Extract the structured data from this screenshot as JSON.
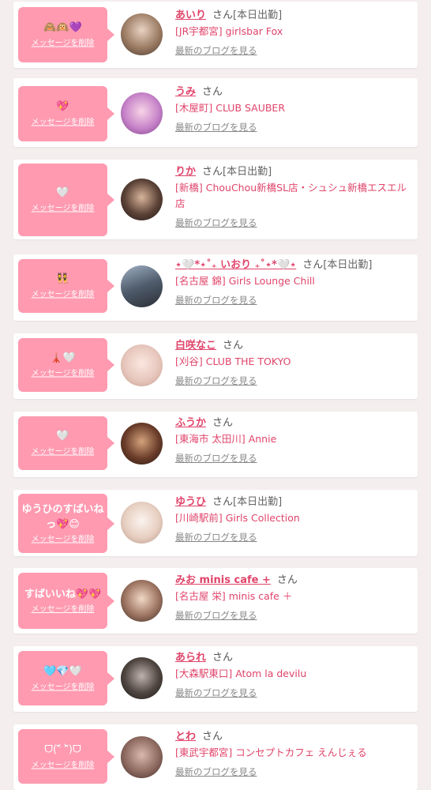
{
  "delete_label": "メッセージを削除",
  "san_label": "さん",
  "blog_label": "最新のブログを見る",
  "colors": {
    "accent": "#e0446a",
    "bubble": "#ff9ab0",
    "background": "#f4eeef"
  },
  "entries": [
    {
      "message": "🙈🙉💜",
      "name": "あいり",
      "work_status": "[本日出勤]",
      "shop": "[JR宇都宮] girlsbar Fox"
    },
    {
      "message": "💖",
      "name": "うみ",
      "work_status": "",
      "shop": "[木屋町] CLUB SAUBER"
    },
    {
      "message": "🤍",
      "name": "りか",
      "work_status": "[本日出勤]",
      "shop": "[新橋] ChouChou新橋SL店・シュシュ新橋エスエル店"
    },
    {
      "message": "👯",
      "name": "⋆🤍*⋆˚₊ いおり ₊˚⋆*🤍⋆",
      "work_status": "[本日出勤]",
      "shop": "[名古屋 錦] Girls Lounge Chill"
    },
    {
      "message": "🗼🤍",
      "name": "白咲なこ",
      "work_status": "",
      "shop": "[刈谷] CLUB THE TOKYO"
    },
    {
      "message": "🤍",
      "name": "ふうか",
      "work_status": "",
      "shop": "[東海市 太田川] Annie"
    },
    {
      "message": "ゆうひのすばいねっ💖😊",
      "name": "ゆうひ",
      "work_status": "[本日出勤]",
      "shop": "[川崎駅前] Girls Collection"
    },
    {
      "message": "すばいいね💖💖",
      "name": "みお minis cafe +",
      "work_status": "",
      "shop": "[名古屋 栄] minis cafe ＋"
    },
    {
      "message": "🩵💎🤍",
      "name": "あられ",
      "work_status": "",
      "shop": "[大森駅東口] Atom la devilu"
    },
    {
      "message": "ᗜ(ᵔ᷄ ᵔ᷅)ᗜ",
      "name": "とわ",
      "work_status": "",
      "shop": "[東武宇都宮] コンセプトカフェ えんじぇる"
    }
  ]
}
